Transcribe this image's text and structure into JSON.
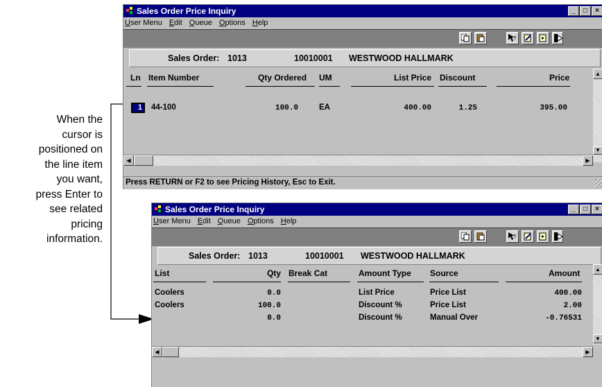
{
  "callout_text": "When the\ncursor is\npositioned on\nthe line item\nyou want,\npress Enter to\nsee related\npricing\ninformation.",
  "window1": {
    "title": "Sales Order Price Inquiry",
    "menu": [
      "User Menu",
      "Edit",
      "Queue",
      "Options",
      "Help"
    ],
    "info": {
      "label": "Sales Order:",
      "order_no": "1013",
      "customer_no": "10010001",
      "customer_name": "WESTWOOD HALLMARK"
    },
    "columns": [
      "Ln",
      "Item Number",
      "Qty Ordered",
      "UM",
      "List Price",
      "Discount",
      "Price"
    ],
    "rows": [
      {
        "ln": "1",
        "item": "44-100",
        "qty": "100.0",
        "um": "EA",
        "list": "400.00",
        "discount": "1.25",
        "price": "395.00"
      }
    ],
    "status": "Press RETURN or F2 to see Pricing History, Esc to Exit."
  },
  "window2": {
    "title": "Sales Order Price Inquiry",
    "menu": [
      "User Menu",
      "Edit",
      "Queue",
      "Options",
      "Help"
    ],
    "info": {
      "label": "Sales Order:",
      "order_no": "1013",
      "customer_no": "10010001",
      "customer_name": "WESTWOOD HALLMARK"
    },
    "columns": [
      "List",
      "Qty",
      "Break Cat",
      "Amount Type",
      "Source",
      "Amount"
    ],
    "rows": [
      {
        "list": "Coolers",
        "qty": "0.0",
        "break": "",
        "type": "List Price",
        "source": "Price List",
        "amount": "400.00"
      },
      {
        "list": "Coolers",
        "qty": "100.0",
        "break": "",
        "type": "Discount %",
        "source": "Price List",
        "amount": "2.00"
      },
      {
        "list": "",
        "qty": "0.0",
        "break": "",
        "type": "Discount %",
        "source": "Manual Over",
        "amount": "-0.76531"
      }
    ]
  },
  "colors": {
    "titlebar": "#000080",
    "window_bg": "#c0c0c0",
    "toolbar": "#808080"
  }
}
